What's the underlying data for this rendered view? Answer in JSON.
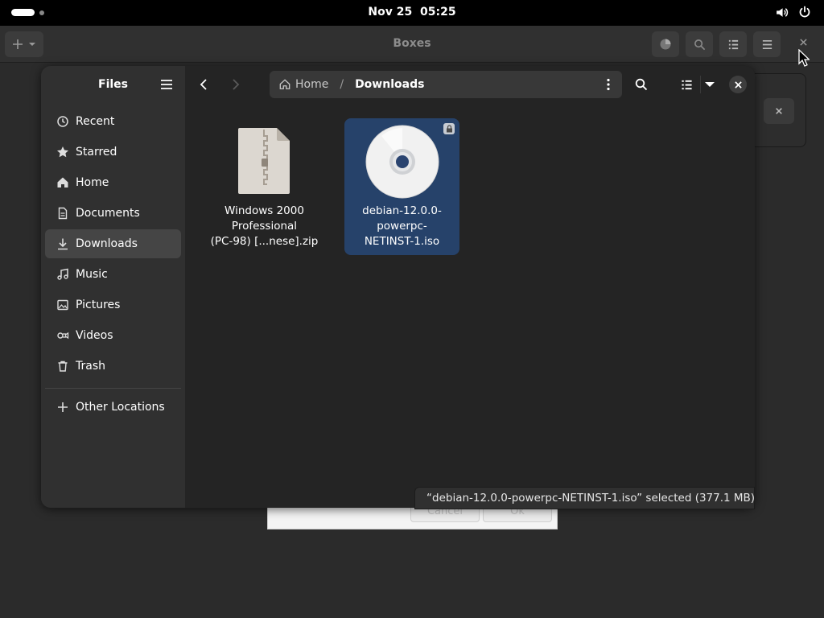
{
  "topbar": {
    "date": "Nov 25",
    "time": "05:25",
    "icons": [
      "activities-indicator",
      "volume-icon",
      "power-icon"
    ]
  },
  "boxes": {
    "title": "Boxes",
    "buttons": [
      "new-plus-icon",
      "storage-pie-icon",
      "search-icon",
      "list-view-icon",
      "menu-icon",
      "close-icon"
    ]
  },
  "background_dialog": {
    "cancel_label": "Cancel",
    "ok_label": "Ok"
  },
  "chooser": {
    "sidebar_title": "Files",
    "places": [
      {
        "label": "Recent",
        "icon": "clock-icon"
      },
      {
        "label": "Starred",
        "icon": "star-icon"
      },
      {
        "label": "Home",
        "icon": "home-icon"
      },
      {
        "label": "Documents",
        "icon": "document-icon"
      },
      {
        "label": "Downloads",
        "icon": "download-icon",
        "active": true
      },
      {
        "label": "Music",
        "icon": "music-icon"
      },
      {
        "label": "Pictures",
        "icon": "picture-icon"
      },
      {
        "label": "Videos",
        "icon": "video-icon"
      },
      {
        "label": "Trash",
        "icon": "trash-icon"
      }
    ],
    "other_locations": "Other Locations",
    "path": {
      "home": "Home",
      "separator": "/",
      "current": "Downloads"
    },
    "files": [
      {
        "name": "Windows 2000\nProfessional\n(PC-98) [...nese].zip",
        "icon": "archive-zip-icon",
        "selected": false
      },
      {
        "name": "debian-12.0.0-\npowerpc-\nNETINST-1.iso",
        "icon": "disc-image-icon",
        "selected": true,
        "emblem": "lock-icon"
      }
    ],
    "status": "“debian-12.0.0-powerpc-NETINST-1.iso” selected  (377.1 MB)"
  },
  "colors": {
    "selection": "#26426a",
    "sidebar_active": "#454545",
    "window_bg": "#242424",
    "sidebar_bg": "#303030"
  }
}
